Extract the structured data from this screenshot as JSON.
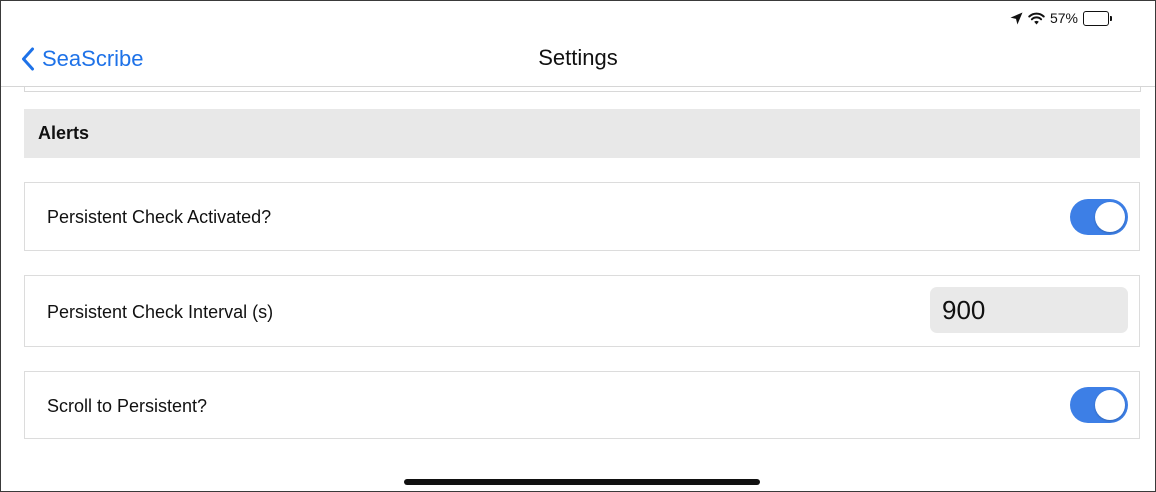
{
  "status_bar": {
    "battery_percent_text": "57%",
    "battery_level": 0.57,
    "icons": [
      "location-arrow-icon",
      "wifi-icon",
      "battery-icon"
    ]
  },
  "nav": {
    "back_label": "SeaScribe",
    "title": "Settings"
  },
  "section": {
    "title": "Alerts"
  },
  "rows": [
    {
      "label": "Persistent Check Activated?",
      "control": "toggle",
      "on": true
    },
    {
      "label": "Persistent Check Interval (s)",
      "control": "number-field",
      "value": "900"
    },
    {
      "label": "Scroll to Persistent?",
      "control": "toggle",
      "on": true
    }
  ],
  "colors": {
    "accent": "#3d7fe6",
    "link": "#1e72e8",
    "section_bg": "#e8e8e8",
    "field_bg": "#e9e9e9"
  }
}
